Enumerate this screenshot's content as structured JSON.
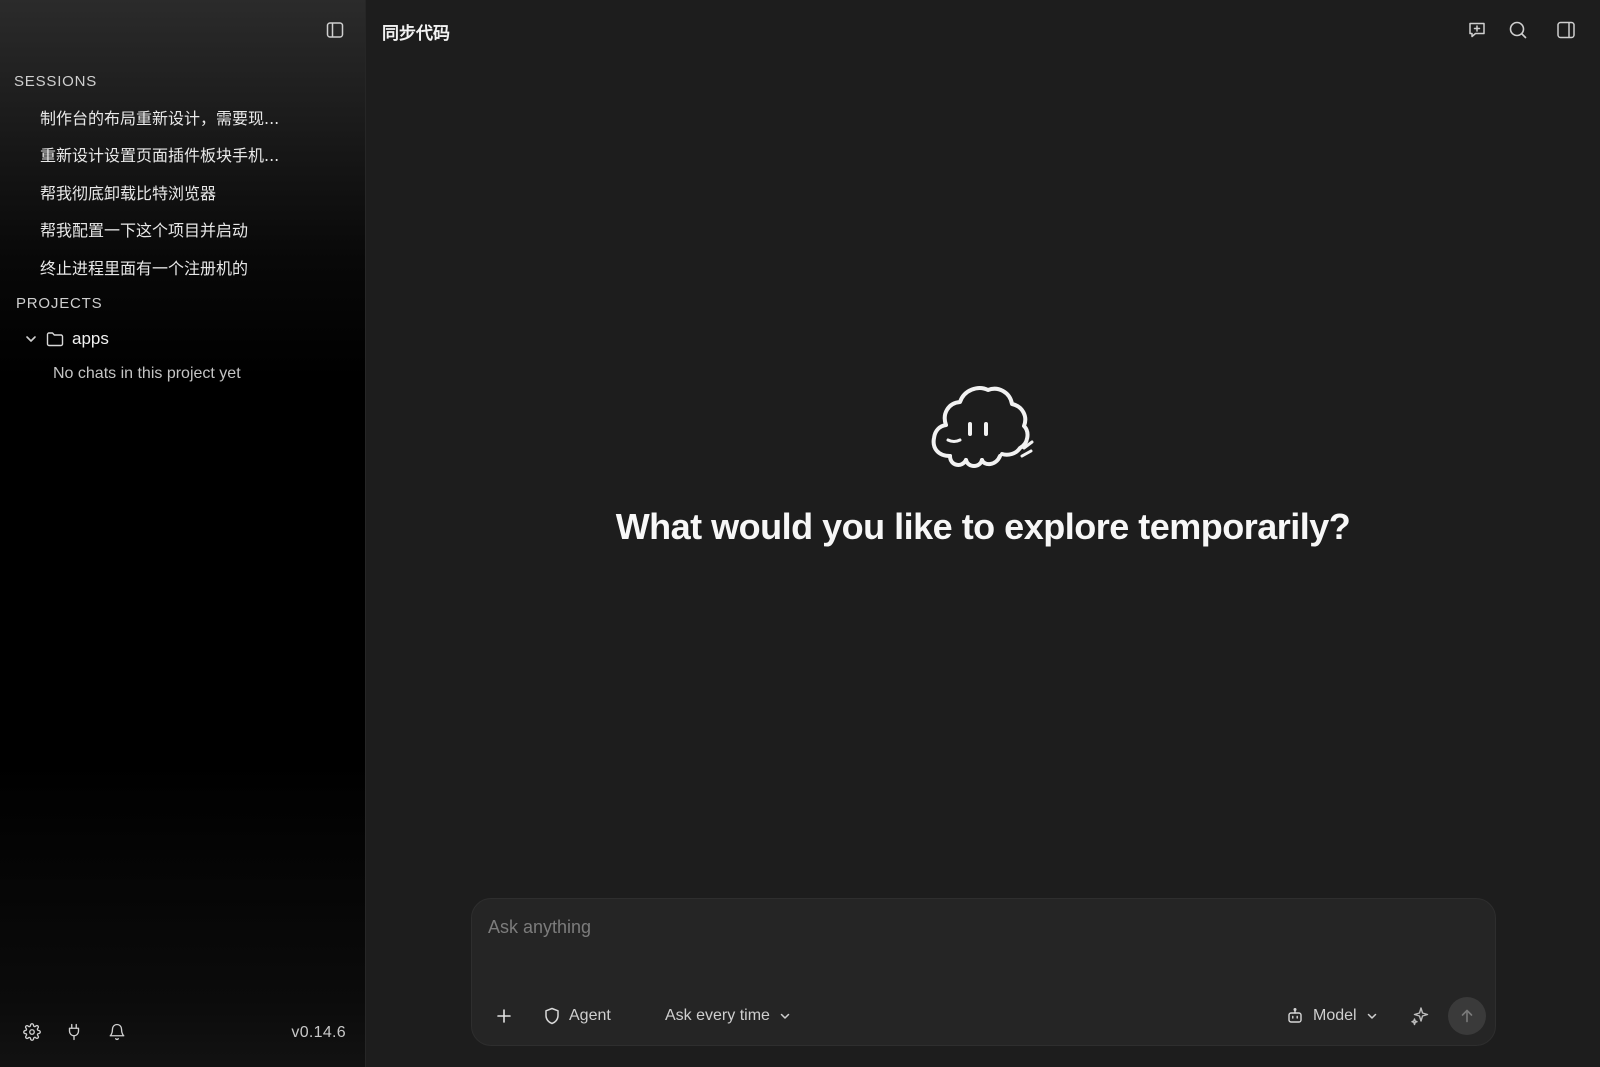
{
  "sidebar": {
    "sessions_label": "SESSIONS",
    "sessions": [
      {
        "title": "制作台的布局重新设计，需要现..."
      },
      {
        "title": "重新设计设置页面插件板块手机..."
      },
      {
        "title": "帮我彻底卸载比特浏览器"
      },
      {
        "title": "帮我配置一下这个项目并启动"
      },
      {
        "title": "终止进程里面有一个注册机的"
      }
    ],
    "projects_label": "PROJECTS",
    "projects": [
      {
        "name": "apps",
        "expanded": true,
        "empty_text": "No chats in this project yet"
      }
    ],
    "footer": {
      "icons": [
        "settings-icon",
        "plug-icon",
        "bell-icon"
      ],
      "version": "v0.14.6"
    }
  },
  "header": {
    "title": "同步代码",
    "icons": [
      "new-chat-icon",
      "search-icon",
      "right-panel-icon"
    ]
  },
  "main": {
    "mascot_icon": "cloud-mascot-icon",
    "heading": "What would you like to explore temporarily?"
  },
  "composer": {
    "placeholder": "Ask anything",
    "agent_label": "Agent",
    "permission_label": "Ask every time",
    "model_label": "Model"
  },
  "colors": {
    "background": "#1d1d1d",
    "sidebar_background": "#000000",
    "composer_background": "#252525",
    "text_primary": "#f2f2f2",
    "text_muted": "#7c7c7c"
  }
}
